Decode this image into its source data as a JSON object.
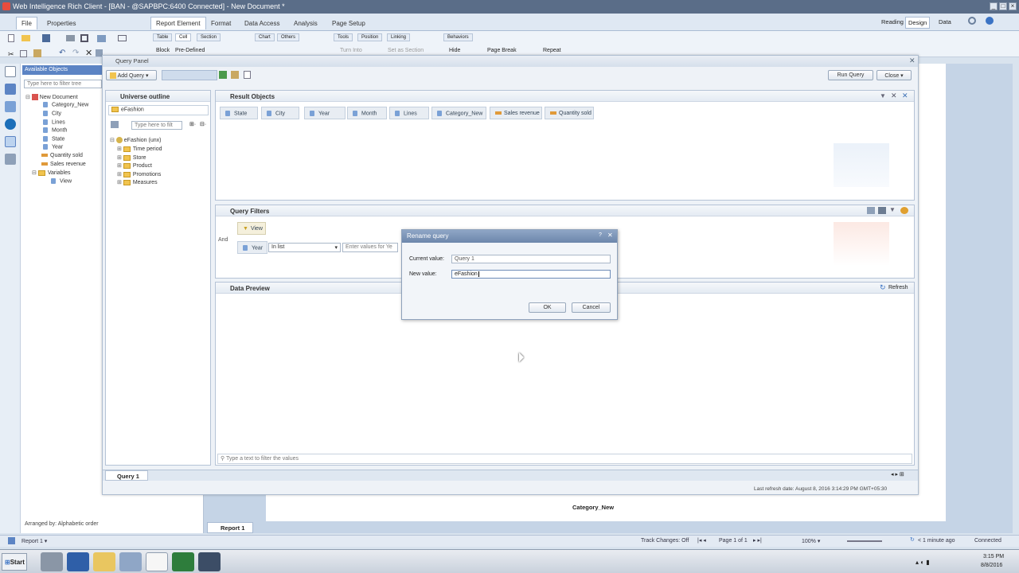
{
  "window": {
    "title": "Web Intelligence Rich Client - [BAN - @SAPBPC:6400 Connected] - New Document *"
  },
  "menu_tabs": [
    {
      "label": "File"
    },
    {
      "label": "Properties"
    },
    {
      "label": "Report Element"
    },
    {
      "label": "Format"
    },
    {
      "label": "Data Access"
    },
    {
      "label": "Analysis"
    },
    {
      "label": "Page Setup"
    }
  ],
  "view_modes": {
    "reading": "Reading",
    "design": "Design",
    "data": "Data"
  },
  "ribbon": {
    "subtabs": [
      "Table",
      "Cell",
      "Section",
      "Chart",
      "Others",
      "Tools",
      "Position",
      "Linking",
      "Behaviors"
    ],
    "block_label": "Block",
    "predefined_label": "Pre-Defined",
    "turn_into": "Turn Into",
    "set_section": "Set as Section",
    "hide": "Hide",
    "page_break": "Page Break",
    "repeat": "Repeat"
  },
  "left_panel": {
    "header": "Available Objects",
    "filter_placeholder": "Type here to filter tree",
    "tree": [
      "New Document",
      "Category_New",
      "City",
      "Lines",
      "Month",
      "State",
      "Year",
      "Quantity sold",
      "Sales revenue",
      "Variables",
      "View"
    ],
    "arranged_by": "Arranged by: Alphabetic order"
  },
  "query_panel": {
    "title": "Query Panel",
    "add_query": "Add Query",
    "run_query": "Run Query",
    "close": "Close",
    "universe_outline": "Universe outline",
    "universe": "eFashion",
    "filter_placeholder": "Type here to filt",
    "universe_root": "eFashion (unx)",
    "universe_tree": [
      "Time period",
      "Store",
      "Product",
      "Promotions",
      "Measures"
    ],
    "result_objects_label": "Result Objects",
    "result_objects": [
      {
        "name": "State",
        "kind": "dim"
      },
      {
        "name": "City",
        "kind": "dim"
      },
      {
        "name": "Year",
        "kind": "dim"
      },
      {
        "name": "Month",
        "kind": "dim"
      },
      {
        "name": "Lines",
        "kind": "dim"
      },
      {
        "name": "Category_New",
        "kind": "dim"
      },
      {
        "name": "Sales revenue",
        "kind": "meas"
      },
      {
        "name": "Quantity sold",
        "kind": "meas"
      }
    ],
    "query_filters_label": "Query Filters",
    "and_label": "And",
    "filter_view": "View",
    "filter_object": "Year",
    "filter_operator": "In list",
    "filter_value_placeholder": "Enter values for Ye",
    "data_preview_label": "Data Preview",
    "refresh": "Refresh",
    "preview_filter_placeholder": "Type a text to filter the values",
    "query_tab": "Query 1",
    "last_refresh": "Last refresh date: August 8, 2016 3:14:29 PM GMT+05:30"
  },
  "dialog": {
    "title": "Rename query",
    "current_value_label": "Current value:",
    "current_value": "Query 1",
    "new_value_label": "New value:",
    "new_value": "eFashion",
    "ok": "OK",
    "cancel": "Cancel"
  },
  "report": {
    "column_header": "Category_New",
    "tab": "Report 1"
  },
  "status": {
    "report_selector": "Report 1",
    "track_changes": "Track Changes: Off",
    "page": "Page 1 of 1",
    "zoom": "100%",
    "refresh_ago": "< 1 minute ago",
    "connected": "Connected"
  },
  "taskbar": {
    "start": "Start",
    "time": "3:15 PM",
    "date": "8/8/2016"
  }
}
